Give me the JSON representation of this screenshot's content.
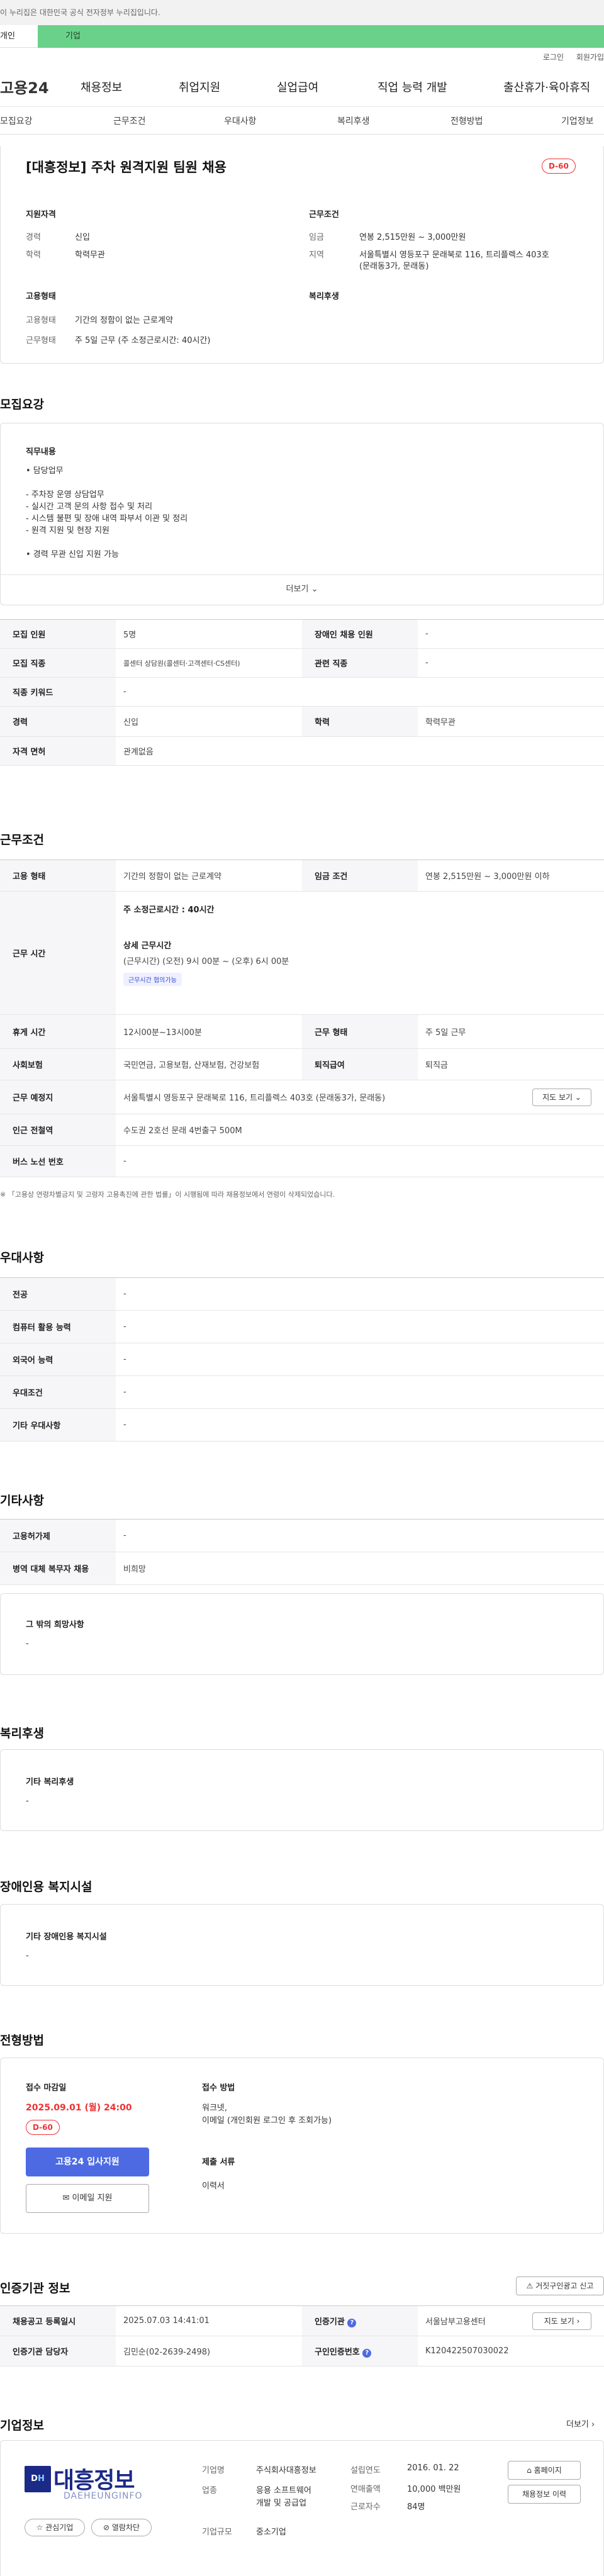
{
  "gov_notice": "이 누리집은 대한민국 공식 전자정부 누리집입니다.",
  "tabs": {
    "person": "개인",
    "corp": "기업"
  },
  "util": {
    "login": "로그인",
    "join": "회원가입"
  },
  "logo": "고용24",
  "gnb": [
    "채용정보",
    "취업지원",
    "실업급여",
    "직업 능력 개발",
    "출산휴가·육아휴직"
  ],
  "anchors": [
    "모집요강",
    "근무조건",
    "우대사항",
    "복리후생",
    "전형방법",
    "기업정보"
  ],
  "header": {
    "title": "[대흥정보] 주차 원격지원 팀원 채용",
    "dday": "D-60",
    "qual_title": "지원자격",
    "career_label": "경력",
    "career_value": "신입",
    "edu_label": "학력",
    "edu_value": "학력무관",
    "work_title": "근무조건",
    "wage_label": "임금",
    "wage_value": "연봉 2,515만원 ~ 3,000만원",
    "area_label": "지역",
    "area_value1": "서울특별시 영등포구 문래북로 116, 트리플렉스 403호",
    "area_value2": "(문래동3가, 문래동)",
    "emp_title": "고용형태",
    "emptype_label": "고용형태",
    "emptype_value": "기간의 정함이 없는 근로계약",
    "hours_label": "근무형태",
    "hours_value": "주 5일 근무 (주 소정근로시간: 40시간)",
    "welfare_title": "복리후생"
  },
  "recruit": {
    "section_title": "모집요강",
    "duty_title": "직무내용",
    "duty_lines": [
      "• 담당업무",
      "",
      "- 주차장 운영 상담업무",
      "- 실시간 고객 문의 사항 접수 및 처리",
      "- 시스템 불편 및 장애 내역 파부서 이관 및 정리",
      "- 원격 지원 및 현장 지원",
      "",
      "• 경력 무관 신입 지원 가능"
    ],
    "more": "더보기",
    "rows": [
      {
        "k1": "모집 인원",
        "v1": "5명",
        "k2": "장애인 채용 인원",
        "v2": "-"
      },
      {
        "k1": "모집 직종",
        "v1": "콜센터 상담원(콜센터·고객센터·CS센터)",
        "k2": "관련 직종",
        "v2": "-"
      },
      {
        "k1": "직종 키워드",
        "v1": "-"
      },
      {
        "k1": "경력",
        "v1": "신입",
        "k2": "학력",
        "v2": "학력무관"
      },
      {
        "k1": "자격 면허",
        "v1": "관계없음"
      }
    ]
  },
  "work": {
    "section_title": "근무조건",
    "emp_k": "고용 형태",
    "emp_v": "기간의 정함이 없는 근로계약",
    "wage_k": "임금 조건",
    "wage_v": "연봉 2,515만원 ~ 3,000만원 이하",
    "time_k": "근무 시간",
    "time_main": "주 소정근로시간 : 40시간",
    "time_detail_title": "상세 근무시간",
    "time_detail": "(근무시간) (오전) 9시 00분 ~ (오후) 6시 00분",
    "time_chip": "근무시간 협의가능",
    "rest_k": "휴게 시간",
    "rest_v": "12시00분~13시00분",
    "shape_k": "근무 형태",
    "shape_v": "주 5일 근무",
    "ins_k": "사회보험",
    "ins_v": "국민연금, 고용보험, 산재보험, 건강보험",
    "ret_k": "퇴직급여",
    "ret_v": "퇴직금",
    "place_k": "근무 예정지",
    "place_v": "서울특별시 영등포구 문래북로 116, 트리플렉스 403호 (문래동3가, 문래동)",
    "map_btn": "지도 보기",
    "subway_k": "인근 전철역",
    "subway_v": "수도권 2호선 문래 4번출구 500M",
    "bus_k": "버스 노선 번호",
    "bus_v": "-",
    "notice": "※ 「고용상 연령차별금지 및 고령자 고용촉진에 관한 법률」이 시행됨에 따라 채용정보에서 연령이 삭제되었습니다."
  },
  "pref": {
    "section_title": "우대사항",
    "rows": [
      [
        "전공",
        "-"
      ],
      [
        "컴퓨터 활용 능력",
        "-"
      ],
      [
        "외국어 능력",
        "-"
      ],
      [
        "우대조건",
        "-"
      ],
      [
        "기타 우대사항",
        "-"
      ]
    ]
  },
  "etc": {
    "section_title": "기타사항",
    "rows": [
      [
        "고용허가제",
        "-"
      ],
      [
        "병역 대체 복무자 채용",
        "비희망"
      ]
    ],
    "box_title": "그 밖의 희망사항",
    "box_value": "-"
  },
  "welfare": {
    "section_title": "복리후생",
    "box_title": "기타 복리후생",
    "box_value": "-"
  },
  "disabled": {
    "section_title": "장애인용 복지시설",
    "box_title": "기타 장애인용 복지시설",
    "box_value": "-"
  },
  "process": {
    "section_title": "전형방법",
    "deadline_title": "접수 마감일",
    "deadline": "2025.09.01 (월) 24:00",
    "dday": "D-60",
    "apply_btn": "고용24 입사지원",
    "email_btn": "이메일 지원",
    "method_title": "접수 방법",
    "method_lines": [
      "워크넷,",
      "이메일 (개인회원 로그인 후 조회가능)"
    ],
    "docs_title": "제출 서류",
    "docs_value": "이력서"
  },
  "cert": {
    "section_title": "인증기관 정보",
    "report_btn": "거짓구인광고 신고",
    "reg_k": "채용공고 등록일시",
    "reg_v": "2025.07.03 14:41:01",
    "agency_k": "인증기관",
    "agency_v": "서울남부고용센터",
    "map_btn": "지도 보기",
    "manager_k": "인증기관 담당자",
    "manager_v": "김민순(02-2639-2498)",
    "no_k": "구인인증번호",
    "no_v": "K120422507030022"
  },
  "company": {
    "section_title": "기업정보",
    "more": "더보기",
    "logo_text": "대흥정보",
    "logo_sub": "DAEHEUNGINFO",
    "fav_btn": "관심기업",
    "block_btn": "열람차단",
    "name_k": "기업명",
    "name_v": "주식회사대흥정보",
    "ind_k": "업종",
    "ind_v1": "응용 소프트웨어",
    "ind_v2": "개발 및 공급업",
    "size_k": "기업규모",
    "size_v": "중소기업",
    "est_k": "설립연도",
    "est_v": "2016. 01. 22",
    "sales_k": "연매출액",
    "sales_v": "10,000 백만원",
    "emp_k": "근로자수",
    "emp_v": "84명",
    "home_btn": "홈페이지",
    "list_btn": "채용정보 이력"
  }
}
